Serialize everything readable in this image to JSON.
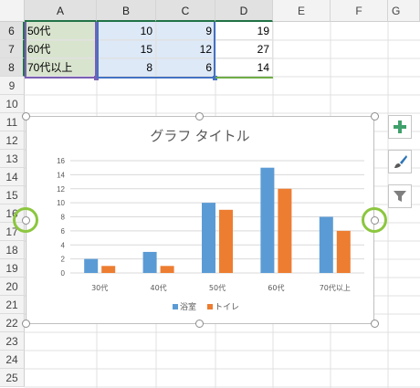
{
  "columns": [
    "A",
    "B",
    "C",
    "D",
    "E",
    "F",
    "G"
  ],
  "row_numbers": [
    "6",
    "7",
    "8",
    "9",
    "10",
    "11",
    "12",
    "13",
    "14",
    "15",
    "16",
    "17",
    "18",
    "19",
    "20",
    "21",
    "22",
    "23",
    "24",
    "25"
  ],
  "table_rows": [
    {
      "label": "50代",
      "bath": "10",
      "toilet": "9",
      "total": "19"
    },
    {
      "label": "60代",
      "bath": "15",
      "toilet": "12",
      "total": "27"
    },
    {
      "label": "70代以上",
      "bath": "8",
      "toilet": "6",
      "total": "14"
    }
  ],
  "chart": {
    "title": "グラフ タイトル",
    "legend": [
      "浴室",
      "トイレ"
    ]
  },
  "colors": {
    "series1": "#5b9bd5",
    "series2": "#ed7d31",
    "category_range": "#7b5fb5",
    "value_range": "#4472c4",
    "total_range": "#70ad47",
    "selection_ring": "#8cc63f"
  },
  "side_buttons": [
    "plus-icon",
    "brush-icon",
    "filter-icon"
  ],
  "chart_data": {
    "type": "bar",
    "title": "グラフ タイトル",
    "categories": [
      "30代",
      "40代",
      "50代",
      "60代",
      "70代以上"
    ],
    "series": [
      {
        "name": "浴室",
        "values": [
          2,
          3,
          10,
          15,
          8
        ]
      },
      {
        "name": "トイレ",
        "values": [
          1,
          1,
          9,
          12,
          6
        ]
      }
    ],
    "ylim": [
      0,
      16
    ],
    "yticks": [
      "0",
      "2",
      "4",
      "6",
      "8",
      "10",
      "12",
      "14",
      "16"
    ],
    "grid": true,
    "legend_position": "bottom"
  }
}
